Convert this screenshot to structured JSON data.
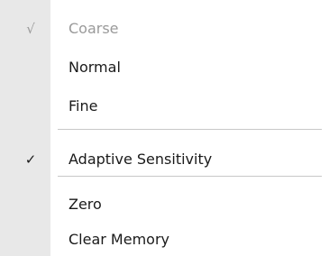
{
  "menu": {
    "items": [
      {
        "label": "Coarse",
        "check": "√"
      },
      {
        "label": "Normal",
        "check": ""
      },
      {
        "label": "Fine",
        "check": ""
      },
      {
        "label": "Adaptive Sensitivity",
        "check": "✓"
      },
      {
        "label": "Zero",
        "check": ""
      },
      {
        "label": "Clear Memory",
        "check": ""
      }
    ]
  }
}
